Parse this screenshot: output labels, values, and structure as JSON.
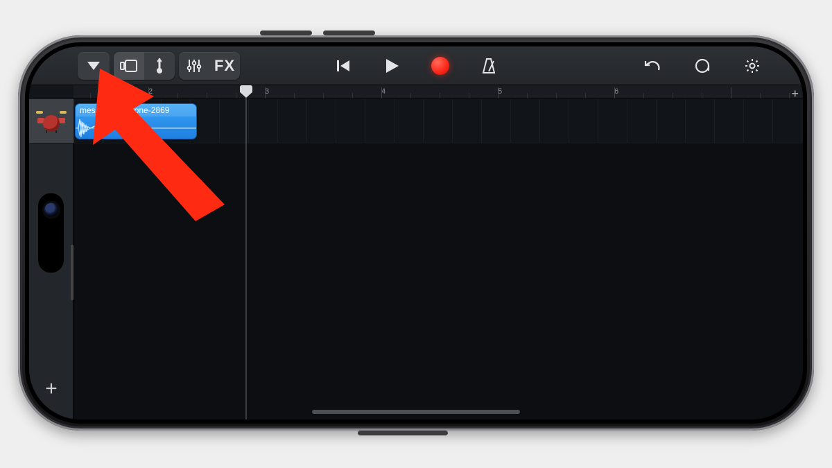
{
  "toolbar": {
    "my_songs_label": "▼",
    "fx_label": "FX"
  },
  "ruler": {
    "bars": [
      2,
      3,
      4,
      5,
      6
    ]
  },
  "track": {
    "instrument_name": "Drums",
    "region_name": "message_ringtone-2869"
  },
  "colors": {
    "record": "#ff2a1c",
    "region": "#2a8ae8",
    "arrow": "#ff2a12"
  }
}
